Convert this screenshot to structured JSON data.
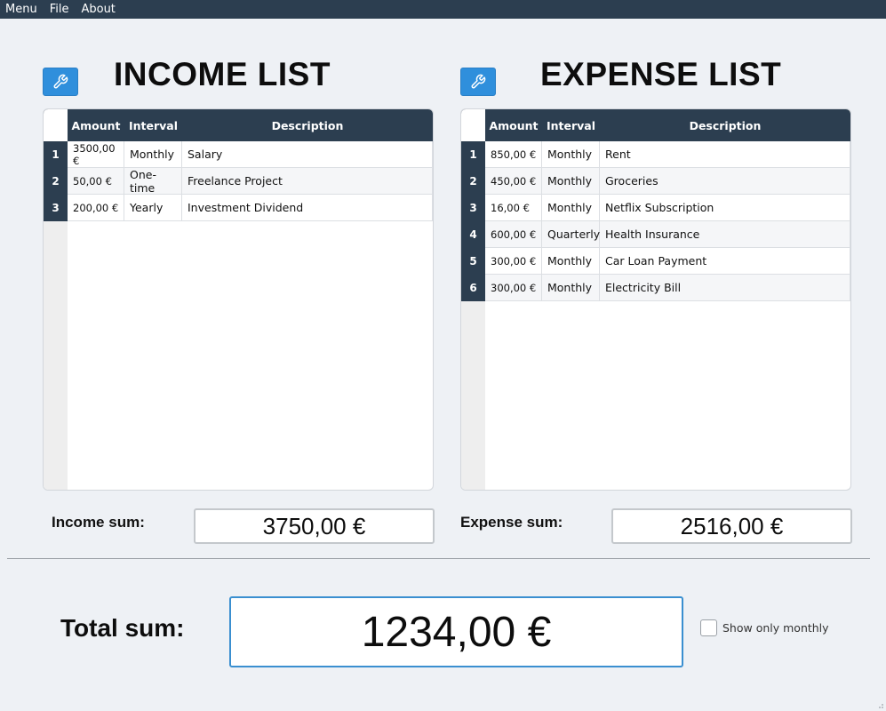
{
  "menubar": {
    "items": [
      "Menu",
      "File",
      "About"
    ]
  },
  "income": {
    "title": "INCOME LIST",
    "columns": [
      "Amount",
      "Interval",
      "Description"
    ],
    "rows": [
      {
        "num": "1",
        "amount": "3500,00 €",
        "interval": "Monthly",
        "description": "Salary"
      },
      {
        "num": "2",
        "amount": "50,00 €",
        "interval": "One-time",
        "description": "Freelance Project"
      },
      {
        "num": "3",
        "amount": "200,00 €",
        "interval": "Yearly",
        "description": "Investment Dividend"
      }
    ],
    "sum_label": "Income sum:",
    "sum_value": "3750,00 €"
  },
  "expense": {
    "title": "EXPENSE LIST",
    "columns": [
      "Amount",
      "Interval",
      "Description"
    ],
    "rows": [
      {
        "num": "1",
        "amount": "850,00 €",
        "interval": "Monthly",
        "description": "Rent"
      },
      {
        "num": "2",
        "amount": "450,00 €",
        "interval": "Monthly",
        "description": "Groceries"
      },
      {
        "num": "3",
        "amount": "16,00 €",
        "interval": "Monthly",
        "description": "Netflix Subscription"
      },
      {
        "num": "4",
        "amount": "600,00 €",
        "interval": "Quarterly",
        "description": "Health Insurance"
      },
      {
        "num": "5",
        "amount": "300,00 €",
        "interval": "Monthly",
        "description": "Car Loan Payment"
      },
      {
        "num": "6",
        "amount": "300,00 €",
        "interval": "Monthly",
        "description": "Electricity Bill"
      }
    ],
    "sum_label": "Expense sum:",
    "sum_value": "2516,00 €"
  },
  "total": {
    "label": "Total sum:",
    "value": "1234,00 €",
    "checkbox_label": "Show only monthly",
    "checkbox_checked": false
  },
  "icons": {
    "edit_button": "wrench-icon"
  },
  "colors": {
    "header": "#2c3e50",
    "accent": "#2f8fdc",
    "total_border": "#3a8fd0"
  }
}
